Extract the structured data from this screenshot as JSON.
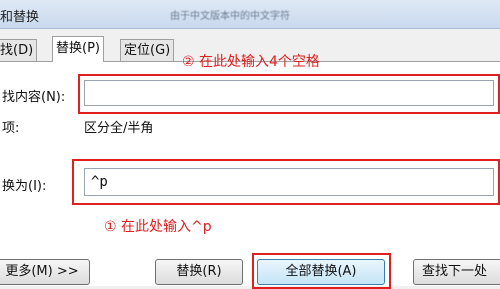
{
  "window": {
    "title": "和替换",
    "title_hint": "由于中文版本中的中文字符"
  },
  "tabs": [
    {
      "label": "找(D)"
    },
    {
      "label": "替换(P)"
    },
    {
      "label": "定位(G)"
    }
  ],
  "find": {
    "label": "找内容(N):",
    "value": "",
    "options_label": "项:",
    "options_value": "区分全/半角"
  },
  "replace": {
    "label": "换为(I):",
    "value": "^p"
  },
  "annotations": {
    "find_note": "② 在此处输入4个空格",
    "replace_note": "① 在此处输入^p",
    "color": "#e02020"
  },
  "buttons": {
    "more": "更多(M) >>",
    "replace": "替换(R)",
    "replace_all": "全部替换(A)",
    "find_next": "查找下一处"
  }
}
